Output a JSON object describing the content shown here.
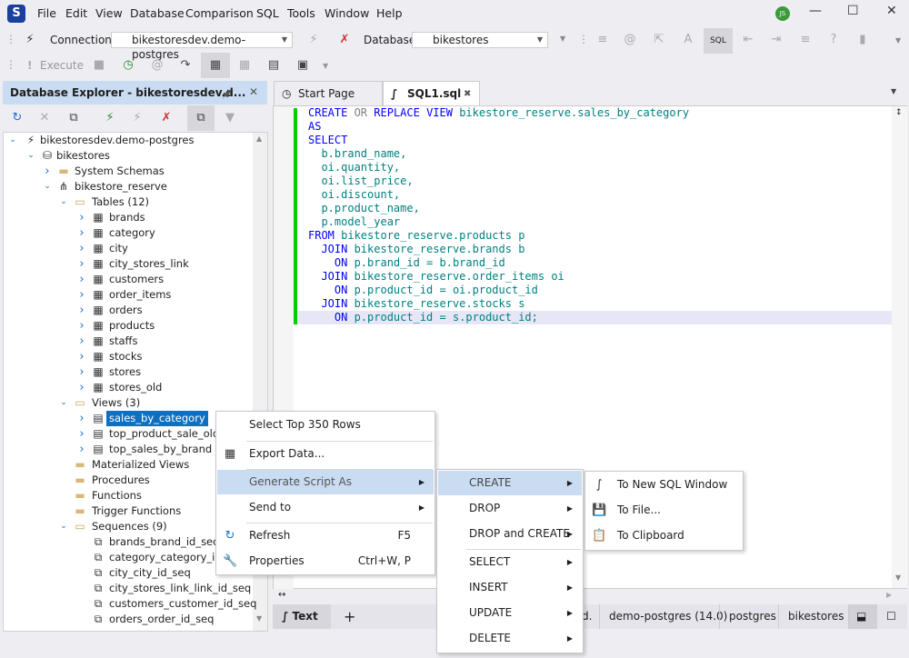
{
  "app": {
    "logo": "S",
    "user_initials": "JS"
  },
  "menu": [
    "File",
    "Edit",
    "View",
    "Database",
    "Comparison",
    "SQL",
    "Tools",
    "Window",
    "Help"
  ],
  "toolbar": {
    "connection_label": "Connection",
    "connection_value": "bikestoresdev.demo-postgres",
    "database_label": "Database",
    "database_value": "bikestores",
    "execute_label": "Execute",
    "sql_check_label": "SQL"
  },
  "explorer": {
    "title": "Database Explorer - bikestoresdev.d...",
    "tree": [
      {
        "lvl": 0,
        "exp": "open",
        "icon": "plug",
        "text": "bikestoresdev.demo-postgres"
      },
      {
        "lvl": 1,
        "exp": "open",
        "icon": "database",
        "text": "bikestores"
      },
      {
        "lvl": 2,
        "exp": "closed",
        "icon": "folder",
        "text": "System Schemas"
      },
      {
        "lvl": 2,
        "exp": "open",
        "icon": "schema",
        "text": "bikestore_reserve"
      },
      {
        "lvl": 3,
        "exp": "open",
        "icon": "folder-open",
        "text": "Tables (12)"
      },
      {
        "lvl": 4,
        "exp": "closed",
        "icon": "table",
        "text": "brands"
      },
      {
        "lvl": 4,
        "exp": "closed",
        "icon": "table",
        "text": "category"
      },
      {
        "lvl": 4,
        "exp": "closed",
        "icon": "table",
        "text": "city"
      },
      {
        "lvl": 4,
        "exp": "closed",
        "icon": "table",
        "text": "city_stores_link"
      },
      {
        "lvl": 4,
        "exp": "closed",
        "icon": "table",
        "text": "customers"
      },
      {
        "lvl": 4,
        "exp": "closed",
        "icon": "table",
        "text": "order_items"
      },
      {
        "lvl": 4,
        "exp": "closed",
        "icon": "table",
        "text": "orders"
      },
      {
        "lvl": 4,
        "exp": "closed",
        "icon": "table",
        "text": "products"
      },
      {
        "lvl": 4,
        "exp": "closed",
        "icon": "table",
        "text": "staffs"
      },
      {
        "lvl": 4,
        "exp": "closed",
        "icon": "table",
        "text": "stocks"
      },
      {
        "lvl": 4,
        "exp": "closed",
        "icon": "table",
        "text": "stores"
      },
      {
        "lvl": 4,
        "exp": "closed",
        "icon": "table",
        "text": "stores_old"
      },
      {
        "lvl": 3,
        "exp": "open",
        "icon": "folder-open",
        "text": "Views (3)"
      },
      {
        "lvl": 4,
        "exp": "closed",
        "icon": "view",
        "text": "sales_by_category",
        "selected": true
      },
      {
        "lvl": 4,
        "exp": "closed",
        "icon": "view",
        "text": "top_product_sale_old"
      },
      {
        "lvl": 4,
        "exp": "closed",
        "icon": "view",
        "text": "top_sales_by_brand"
      },
      {
        "lvl": 3,
        "exp": "none",
        "icon": "folder",
        "text": "Materialized Views"
      },
      {
        "lvl": 3,
        "exp": "none",
        "icon": "folder",
        "text": "Procedures"
      },
      {
        "lvl": 3,
        "exp": "none",
        "icon": "folder",
        "text": "Functions"
      },
      {
        "lvl": 3,
        "exp": "none",
        "icon": "folder",
        "text": "Trigger Functions"
      },
      {
        "lvl": 3,
        "exp": "open",
        "icon": "folder-open",
        "text": "Sequences (9)"
      },
      {
        "lvl": 4,
        "exp": "none",
        "icon": "sequence",
        "text": "brands_brand_id_seq"
      },
      {
        "lvl": 4,
        "exp": "none",
        "icon": "sequence",
        "text": "category_category_id_seq"
      },
      {
        "lvl": 4,
        "exp": "none",
        "icon": "sequence",
        "text": "city_city_id_seq"
      },
      {
        "lvl": 4,
        "exp": "none",
        "icon": "sequence",
        "text": "city_stores_link_link_id_seq"
      },
      {
        "lvl": 4,
        "exp": "none",
        "icon": "sequence",
        "text": "customers_customer_id_seq"
      },
      {
        "lvl": 4,
        "exp": "none",
        "icon": "sequence",
        "text": "orders_order_id_seq"
      }
    ]
  },
  "tabs": [
    {
      "label": "Start Page"
    },
    {
      "label": "SQL1.sql",
      "active": true
    }
  ],
  "editor": {
    "lines": [
      [
        [
          "k",
          "CREATE "
        ],
        [
          "g",
          "OR "
        ],
        [
          "k",
          "REPLACE VIEW "
        ],
        [
          "i",
          "bikestore_reserve.sales_by_category"
        ]
      ],
      [
        [
          "k",
          "AS"
        ]
      ],
      [
        [
          "k",
          "SELECT"
        ]
      ],
      [
        [
          "i",
          "  b.brand_name,"
        ]
      ],
      [
        [
          "i",
          "  oi.quantity,"
        ]
      ],
      [
        [
          "i",
          "  oi.list_price,"
        ]
      ],
      [
        [
          "i",
          "  oi.discount,"
        ]
      ],
      [
        [
          "i",
          "  p.product_name,"
        ]
      ],
      [
        [
          "i",
          "  p.model_year"
        ]
      ],
      [
        [
          "k",
          "FROM "
        ],
        [
          "i",
          "bikestore_reserve.products p"
        ]
      ],
      [
        [
          "k",
          "  JOIN "
        ],
        [
          "i",
          "bikestore_reserve.brands b"
        ]
      ],
      [
        [
          "k",
          "    ON "
        ],
        [
          "i",
          "p.brand_id = b.brand_id"
        ]
      ],
      [
        [
          "k",
          "  JOIN "
        ],
        [
          "i",
          "bikestore_reserve.order_items oi"
        ]
      ],
      [
        [
          "k",
          "    ON "
        ],
        [
          "i",
          "p.product_id = oi.product_id"
        ]
      ],
      [
        [
          "k",
          "  JOIN "
        ],
        [
          "i",
          "bikestore_reserve.stocks s"
        ]
      ],
      [
        [
          "k",
          "    ON "
        ],
        [
          "i",
          "p.product_id = s.product_id;"
        ]
      ]
    ]
  },
  "bottom": {
    "text_tab": "Text",
    "add": "+",
    "status": [
      "d.",
      "demo-postgres (14.0)",
      "postgres",
      "bikestores"
    ]
  },
  "context_menu": [
    {
      "label": "Select Top 350 Rows"
    },
    {
      "label": "Export Data...",
      "icon": "export-icon"
    },
    {
      "label": "Generate Script As",
      "submenu": true,
      "highlighted": true
    },
    {
      "label": "Send to",
      "submenu": true
    },
    {
      "label": "Refresh",
      "shortcut": "F5",
      "icon": "refresh-icon"
    },
    {
      "label": "Properties",
      "shortcut": "Ctrl+W, P",
      "icon": "wrench-icon"
    }
  ],
  "script_submenu": [
    "CREATE",
    "DROP",
    "DROP and CREATE",
    "SELECT",
    "INSERT",
    "UPDATE",
    "DELETE"
  ],
  "create_submenu": [
    "To New SQL Window",
    "To File...",
    "To Clipboard"
  ]
}
